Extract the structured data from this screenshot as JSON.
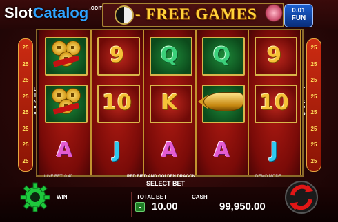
{
  "brand": {
    "slot": "Slot",
    "catalog": "Catalog",
    "com": ".com"
  },
  "header": {
    "title": "- FREE GAMES",
    "free_games_value": "0.01",
    "free_games_label": "FUN"
  },
  "paylines": {
    "left": [
      "25",
      "25",
      "25",
      "25",
      "25",
      "25",
      "25",
      "25"
    ],
    "right": [
      "25",
      "25",
      "25",
      "25",
      "25",
      "25",
      "25",
      "25"
    ],
    "left_label": "LINES",
    "right_label": "FIXED"
  },
  "reels": [
    [
      {
        "type": "coins",
        "icon": "coins-with-red-ribbon"
      },
      {
        "type": "coins",
        "icon": "coins-with-red-ribbon"
      },
      {
        "type": "letter",
        "text": "A",
        "style": "pink"
      }
    ],
    [
      {
        "type": "letter",
        "text": "9",
        "style": "gold",
        "card": "red"
      },
      {
        "type": "letter",
        "text": "10",
        "style": "gold",
        "card": "red"
      },
      {
        "type": "letter",
        "text": "J",
        "style": "cyan"
      }
    ],
    [
      {
        "type": "letter",
        "text": "Q",
        "style": "green",
        "card": "green"
      },
      {
        "type": "letter",
        "text": "K",
        "style": "gold",
        "card": "red"
      },
      {
        "type": "letter",
        "text": "A",
        "style": "pink"
      }
    ],
    [
      {
        "type": "letter",
        "text": "Q",
        "style": "green",
        "card": "green"
      },
      {
        "type": "fish",
        "icon": "golden-fish"
      },
      {
        "type": "letter",
        "text": "A",
        "style": "pink"
      }
    ],
    [
      {
        "type": "letter",
        "text": "9",
        "style": "gold",
        "card": "red"
      },
      {
        "type": "letter",
        "text": "10",
        "style": "gold",
        "card": "red"
      },
      {
        "type": "letter",
        "text": "J",
        "style": "cyan"
      }
    ]
  ],
  "status": {
    "line_bet": "LINE BET: 0.40",
    "game_name": "RED BIRD AND GOLDEN DRAGON",
    "demo_mode": "DEMO MODE",
    "select_bet": "SELECT BET"
  },
  "bottom": {
    "win_label": "WIN",
    "total_bet_label": "TOTAL BET",
    "total_bet_value": "10.00",
    "minus": "-",
    "plus": "+",
    "cash_label": "CASH",
    "cash_value": "99,950.00"
  },
  "colors": {
    "gold": "#f6c238",
    "green": "#3bd07a",
    "pink": "#e35bd1",
    "cyan": "#2fc9f0",
    "settings_green": "#1ec83c",
    "spin_red": "#e01616"
  }
}
